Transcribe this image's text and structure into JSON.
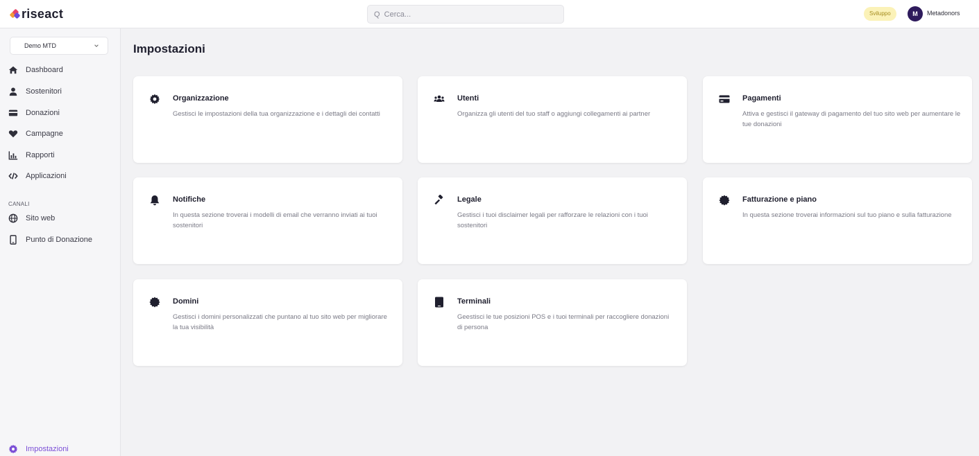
{
  "app": {
    "logo_text": "riseact"
  },
  "search": {
    "placeholder": "Q  Cerca..."
  },
  "topbar": {
    "env_badge": "Sviluppo",
    "avatar_initial": "M",
    "user_name": "Metadonors"
  },
  "sidebar": {
    "org_selector": "Demo MTD",
    "items": [
      {
        "label": "Dashboard",
        "icon": "home-icon"
      },
      {
        "label": "Sostenitori",
        "icon": "user-icon"
      },
      {
        "label": "Donazioni",
        "icon": "card-icon"
      },
      {
        "label": "Campagne",
        "icon": "heart-icon"
      },
      {
        "label": "Rapporti",
        "icon": "chart-icon"
      },
      {
        "label": "Applicazioni",
        "icon": "code-icon"
      }
    ],
    "channels_label": "CANALI",
    "channels": [
      {
        "label": "Sito web",
        "icon": "globe-icon"
      },
      {
        "label": "Punto di Donazione",
        "icon": "mobile-icon"
      }
    ],
    "settings_label": "Impostazioni"
  },
  "main": {
    "title": "Impostazioni",
    "cards": [
      {
        "title": "Organizzazione",
        "description": "Gestisci le impostazioni della tua organizzazione e i dettagli dei contatti",
        "icon": "gear-icon"
      },
      {
        "title": "Utenti",
        "description": "Organizza gli utenti del tuo staff o aggiungi collegamenti ai partner",
        "icon": "users-icon"
      },
      {
        "title": "Pagamenti",
        "description": "Attiva e gestisci il gateway di pagamento del tuo sito web per aumentare le tue donazioni",
        "icon": "credit-card-icon"
      },
      {
        "title": "Notifiche",
        "description": "In questa sezione troverai i modelli di email che verranno inviati ai tuoi sostenitori",
        "icon": "bell-icon"
      },
      {
        "title": "Legale",
        "description": "Gestisci i tuoi disclaimer legali per rafforzare le relazioni con i tuoi sostenitori",
        "icon": "gavel-icon"
      },
      {
        "title": "Fatturazione e piano",
        "description": "In questa sezione troverai informazioni sul tuo piano e sulla fatturazione",
        "icon": "certificate-icon"
      },
      {
        "title": "Domini",
        "description": "Gestisci i domini personalizzati che puntano al tuo sito web per migliorare la tua visibilità",
        "icon": "certificate-icon"
      },
      {
        "title": "Terminali",
        "description": "Geestisci le tue posizioni POS e i tuoi terminali per raccogliere donazioni di persona",
        "icon": "tablet-icon"
      }
    ]
  },
  "colors": {
    "accent": "#7b4fd6",
    "avatar_bg": "#2e1b5c",
    "badge_bg": "#fbf2b8",
    "badge_text": "#a48b1c"
  }
}
